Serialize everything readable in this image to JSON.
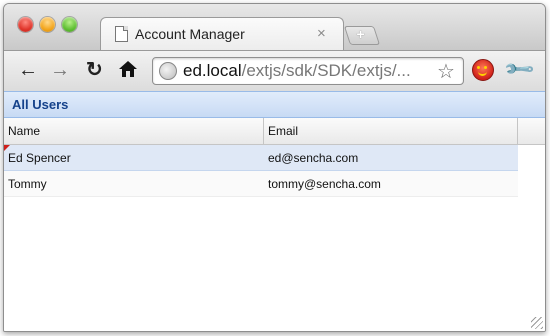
{
  "browser": {
    "tab_title": "Account Manager",
    "tab_close_glyph": "×",
    "new_tab_glyph": "+",
    "url_host": "ed.local",
    "url_path": "/extjs/sdk/SDK/extjs/...",
    "icons": [
      "close-window-icon",
      "minimize-window-icon",
      "maximize-window-icon",
      "page-icon",
      "back-icon",
      "forward-icon",
      "reload-icon",
      "home-icon",
      "globe-icon",
      "star-icon",
      "extension-icon",
      "wrench-icon"
    ]
  },
  "panel": {
    "title": "All Users",
    "columns": [
      {
        "label": "Name"
      },
      {
        "label": "Email"
      }
    ],
    "rows": [
      {
        "name": "Ed Spencer",
        "email": "ed@sencha.com",
        "selected": true,
        "dirty": true
      },
      {
        "name": "Tommy",
        "email": "tommy@sencha.com",
        "selected": false,
        "dirty": false
      }
    ]
  },
  "colors": {
    "panel_title": "#15428b",
    "panel_header_bg": "#c7daf4",
    "selected_row_bg": "#dfe8f6",
    "dirty_marker": "#d0201a"
  }
}
